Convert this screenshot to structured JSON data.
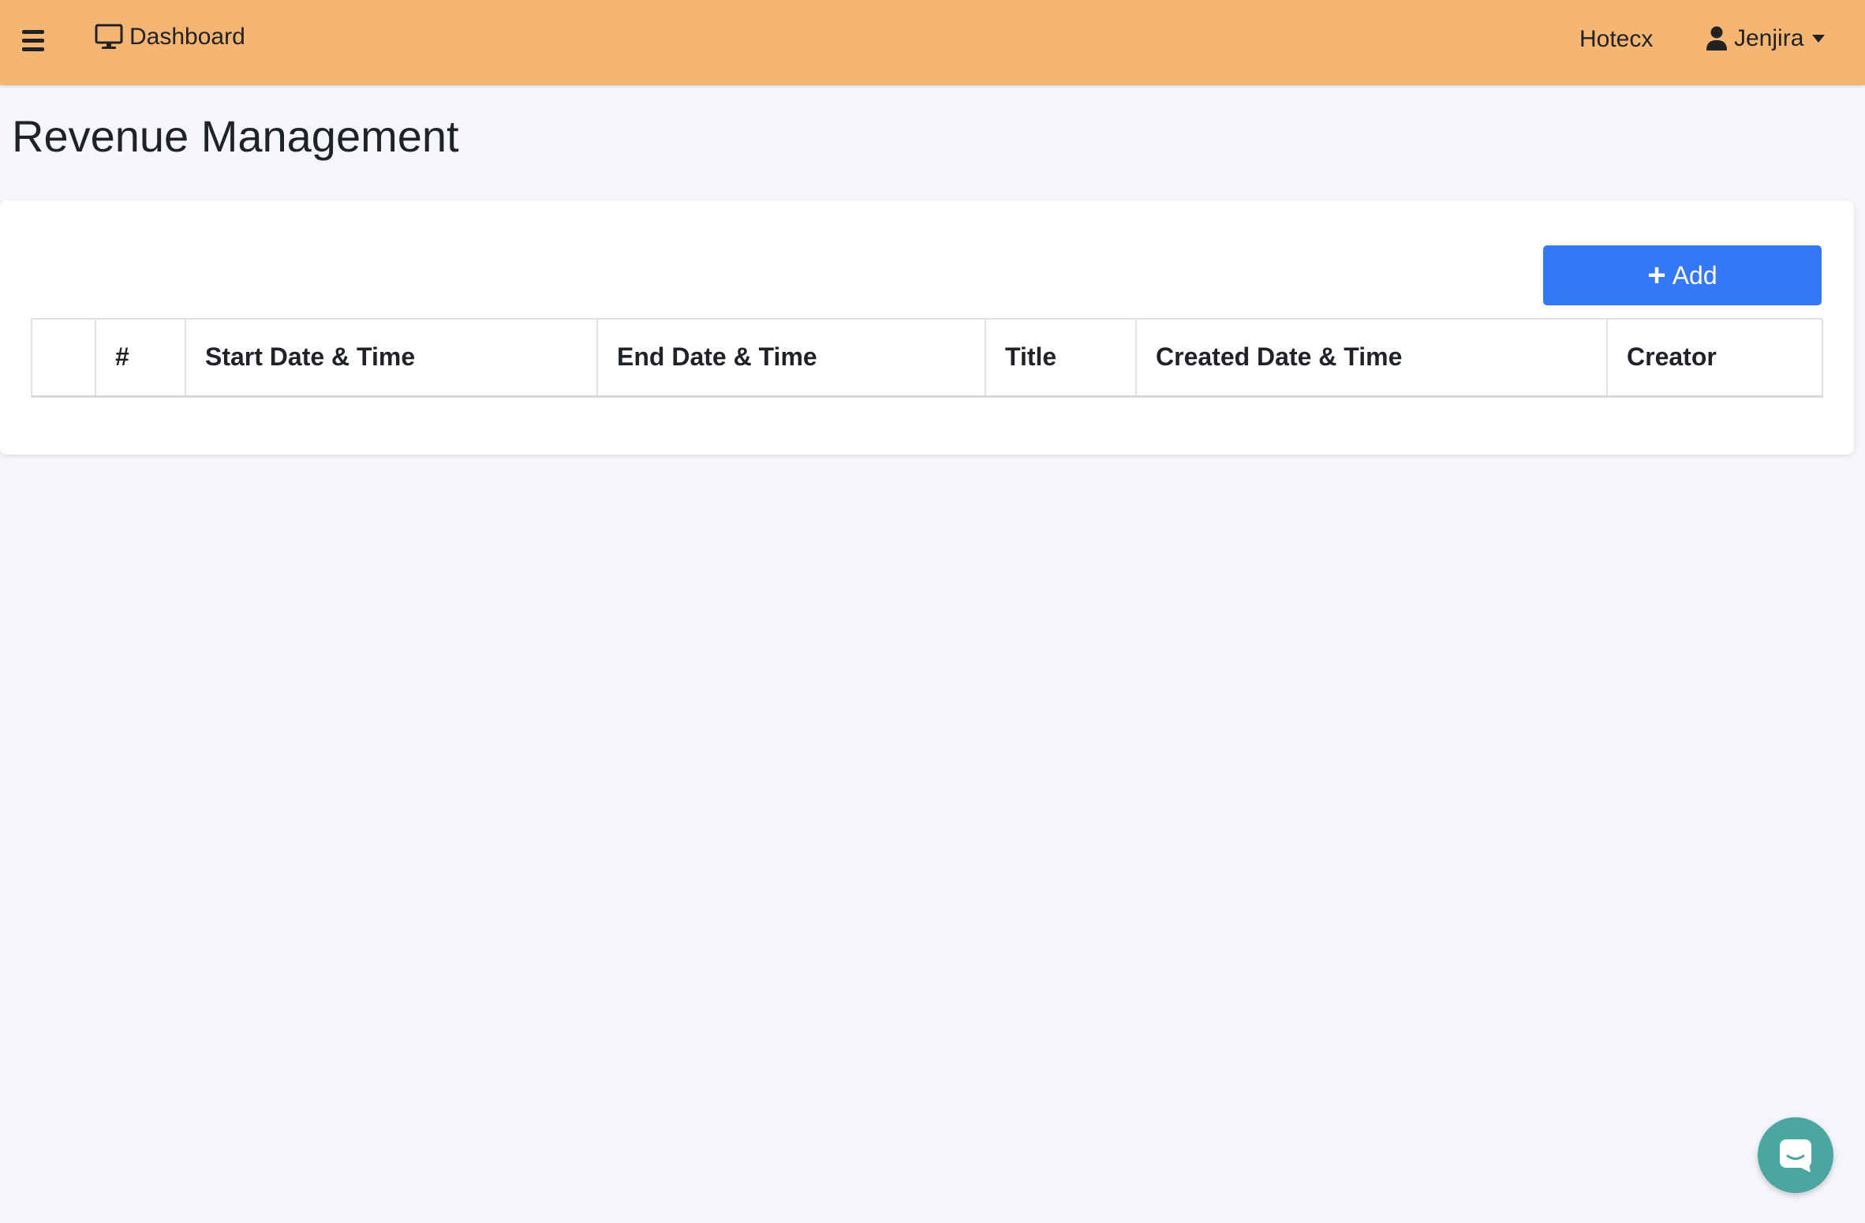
{
  "header": {
    "menu_icon": "hamburger-icon",
    "dashboard_icon": "monitor-icon",
    "dashboard_label": "Dashboard",
    "hotel_name": "Hotecx",
    "user_icon": "user-icon",
    "user_name": "Jenjira",
    "caret_icon": "caret-down-icon",
    "bar_color": "#f5b673"
  },
  "page": {
    "title": "Revenue Management"
  },
  "toolbar": {
    "add_label": "Add",
    "add_icon": "plus-icon",
    "add_color": "#3478f6"
  },
  "table": {
    "columns": [
      "",
      "#",
      "Start Date & Time",
      "End Date & Time",
      "Title",
      "Created Date & Time",
      "Creator"
    ],
    "rows": []
  },
  "chat": {
    "icon": "chat-icon",
    "color": "#4ba6a0"
  }
}
